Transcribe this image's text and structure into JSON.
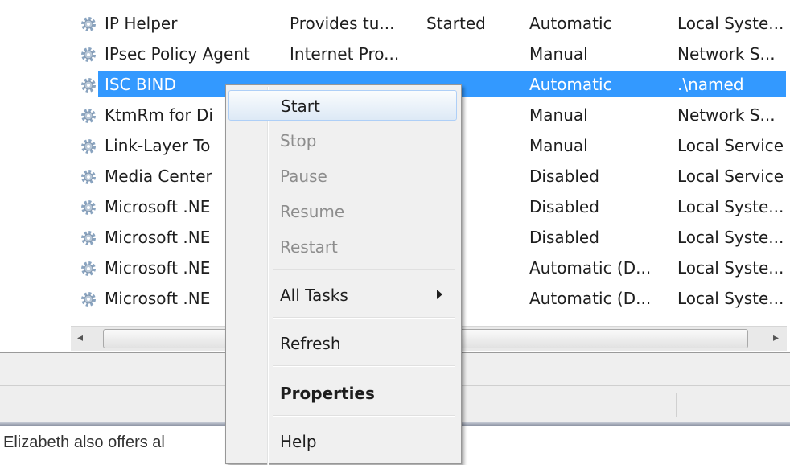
{
  "services": [
    {
      "name": "IP Helper",
      "description": "Provides tu...",
      "status": "Started",
      "startup": "Automatic",
      "logon": "Local Syste..."
    },
    {
      "name": "IPsec Policy Agent",
      "description": "Internet Pro...",
      "status": "",
      "startup": "Manual",
      "logon": "Network S..."
    },
    {
      "name": "ISC BIND",
      "description": "",
      "status": "",
      "startup": "Automatic",
      "logon": ".\\named",
      "selected": true
    },
    {
      "name": "KtmRm for Di",
      "description": "",
      "status": "",
      "startup": "Manual",
      "logon": "Network S..."
    },
    {
      "name": "Link-Layer To",
      "description": "",
      "status": "",
      "startup": "Manual",
      "logon": "Local Service"
    },
    {
      "name": "Media Center",
      "description": "",
      "status": "",
      "startup": "Disabled",
      "logon": "Local Service"
    },
    {
      "name": "Microsoft .NE",
      "description": "",
      "status": "",
      "startup": "Disabled",
      "logon": "Local Syste..."
    },
    {
      "name": "Microsoft .NE",
      "description": "",
      "status": "",
      "startup": "Disabled",
      "logon": "Local Syste..."
    },
    {
      "name": "Microsoft .NE",
      "description": "",
      "status": "",
      "startup": "Automatic (D...",
      "logon": "Local Syste..."
    },
    {
      "name": "Microsoft .NE",
      "description": "",
      "status": "",
      "startup": "Automatic (D...",
      "logon": "Local Syste..."
    }
  ],
  "context_menu": {
    "start": "Start",
    "stop": "Stop",
    "pause": "Pause",
    "resume": "Resume",
    "restart": "Restart",
    "all_tasks": "All Tasks",
    "refresh": "Refresh",
    "properties": "Properties",
    "help": "Help"
  },
  "background_text": "Elizabeth also offers al",
  "colors": {
    "selection": "#3399ff",
    "menu_bg": "#f0f0f0",
    "disabled_text": "#8d8d8d"
  },
  "icons": {
    "service": "gear-icon",
    "submenu": "submenu-arrow-icon"
  }
}
